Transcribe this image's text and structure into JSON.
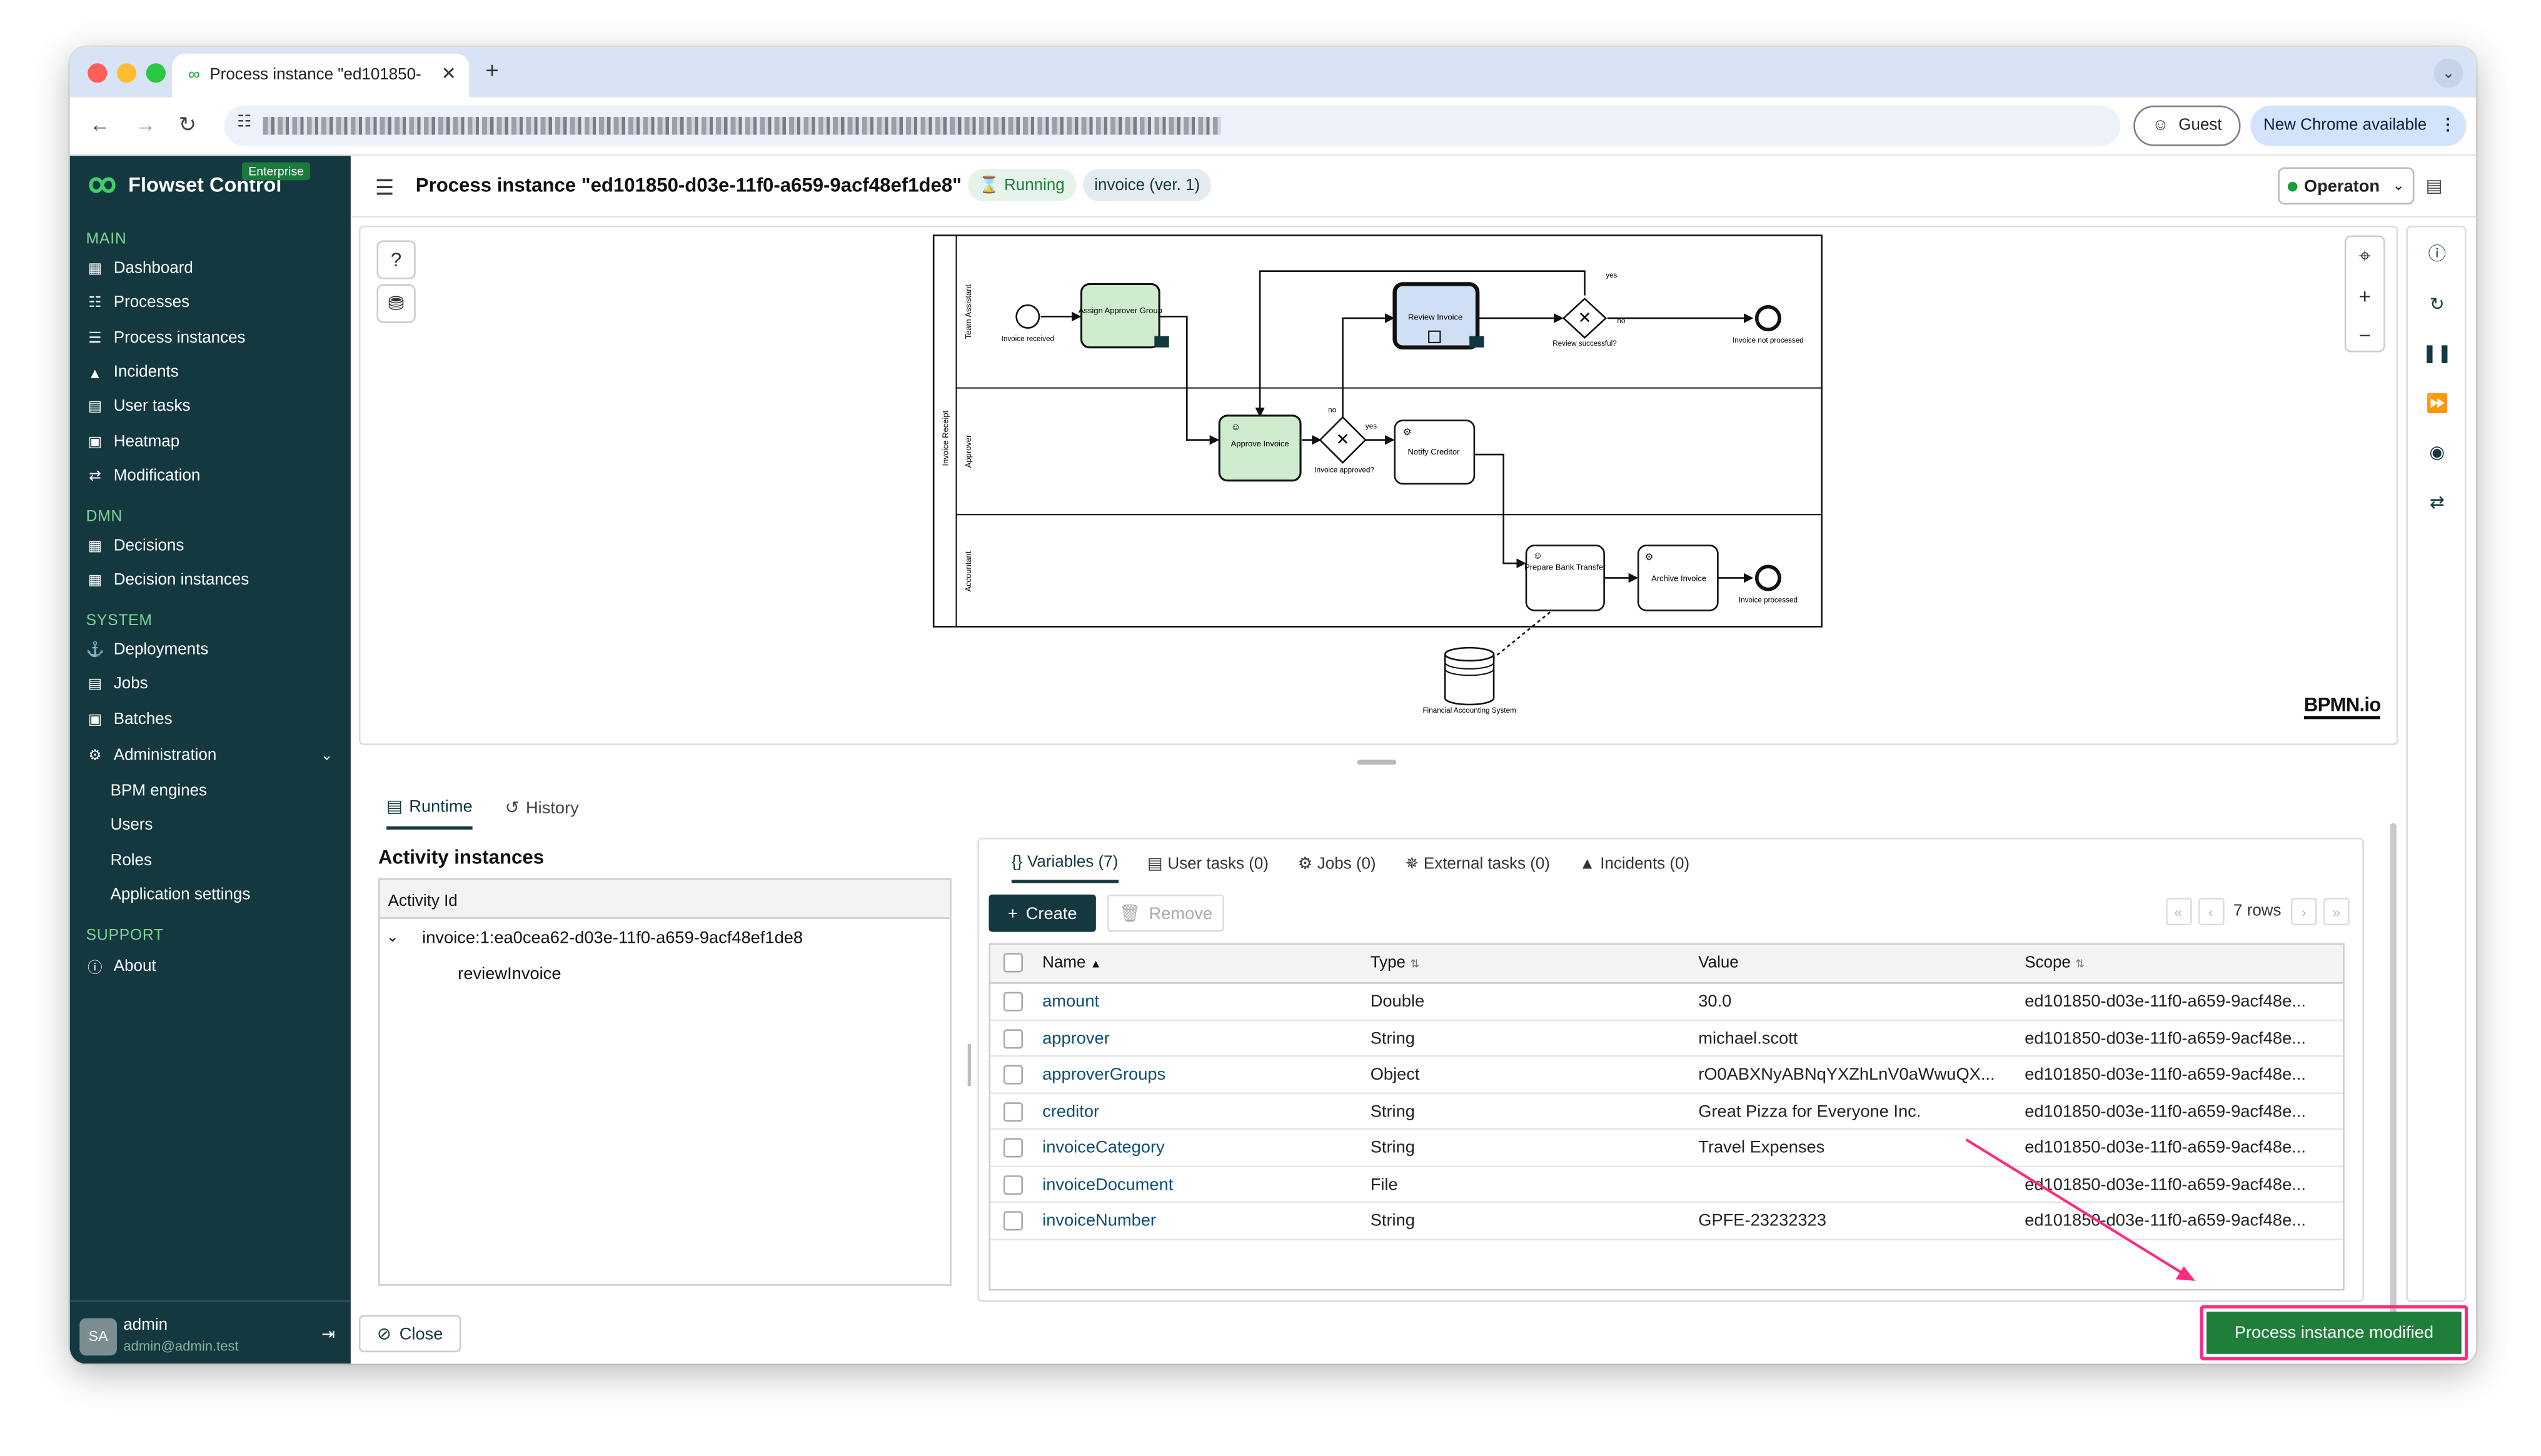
{
  "browser": {
    "tab_title": "Process instance \"ed101850-",
    "guest_label": "Guest",
    "chrome_available_label": "New Chrome available"
  },
  "colors": {
    "sidebar_bg": "#13383f",
    "section_label": "#7fd394",
    "accent": "#13383f",
    "success": "#1e7e3a",
    "highlight": "#ff2a80"
  },
  "sidebar": {
    "brand": "Flowset Control",
    "edition": "Enterprise",
    "sections": {
      "main": "MAIN",
      "dmn": "DMN",
      "system": "SYSTEM",
      "support": "SUPPORT"
    },
    "items": {
      "dashboard": "Dashboard",
      "processes": "Processes",
      "process_instances": "Process instances",
      "incidents": "Incidents",
      "user_tasks": "User tasks",
      "heatmap": "Heatmap",
      "modification": "Modification",
      "decisions": "Decisions",
      "decision_instances": "Decision instances",
      "deployments": "Deployments",
      "jobs": "Jobs",
      "batches": "Batches",
      "administration": "Administration",
      "bpm_engines": "BPM engines",
      "users": "Users",
      "roles": "Roles",
      "application_settings": "Application settings",
      "about": "About"
    },
    "user": {
      "initials": "SA",
      "name": "admin",
      "email": "admin@admin.test"
    }
  },
  "header": {
    "title": "Process instance \"ed101850-d03e-11f0-a659-9acf48ef1de8\"",
    "status": "Running",
    "definition": "invoice (ver. 1)",
    "engine": "Operaton"
  },
  "diagram": {
    "pools": [
      "Invoice Receipt"
    ],
    "lanes": [
      "Team Assistant",
      "Approver",
      "Accountant"
    ],
    "elements": {
      "invoice_received": "Invoice received",
      "assign_approver_group": "Assign Approver Group",
      "review_invoice": "Review Invoice",
      "review_successful": "Review successful?",
      "invoice_not_processed": "Invoice not processed",
      "approve_invoice": "Approve Invoice",
      "invoice_approved": "Invoice approved?",
      "notify_creditor": "Notify Creditor",
      "prepare_bank_transfer": "Prepare Bank Transfer",
      "archive_invoice": "Archive Invoice",
      "invoice_processed": "Invoice processed",
      "financial_accounting_system": "Financial Accounting System"
    },
    "flow_labels": {
      "yes_top": "yes",
      "no_top": "no",
      "yes_mid": "yes",
      "no_mid": "no"
    },
    "watermark": "BPMN.io"
  },
  "bottom_tabs": {
    "runtime": "Runtime",
    "history": "History"
  },
  "activity_instances": {
    "title": "Activity instances",
    "column": "Activity Id",
    "root": "invoice:1:ea0cea62-d03e-11f0-a659-9acf48ef1de8",
    "child": "reviewInvoice"
  },
  "variables_tabs": {
    "variables": "Variables (7)",
    "user_tasks": "User tasks (0)",
    "jobs": "Jobs (0)",
    "external_tasks": "External tasks (0)",
    "incidents": "Incidents (0)"
  },
  "variables": {
    "create_label": "Create",
    "remove_label": "Remove",
    "rows_label": "7 rows",
    "columns": [
      "Name",
      "Type",
      "Value",
      "Scope"
    ],
    "rows": [
      {
        "name": "amount",
        "type": "Double",
        "value": "30.0",
        "scope": "ed101850-d03e-11f0-a659-9acf48e..."
      },
      {
        "name": "approver",
        "type": "String",
        "value": "michael.scott",
        "scope": "ed101850-d03e-11f0-a659-9acf48e..."
      },
      {
        "name": "approverGroups",
        "type": "Object",
        "value": "rO0ABXNyABNqYXZhLnV0aWwuQX...",
        "scope": "ed101850-d03e-11f0-a659-9acf48e..."
      },
      {
        "name": "creditor",
        "type": "String",
        "value": "Great Pizza for Everyone Inc.",
        "scope": "ed101850-d03e-11f0-a659-9acf48e..."
      },
      {
        "name": "invoiceCategory",
        "type": "String",
        "value": "Travel Expenses",
        "scope": "ed101850-d03e-11f0-a659-9acf48e..."
      },
      {
        "name": "invoiceDocument",
        "type": "File",
        "value": "",
        "scope": "ed101850-d03e-11f0-a659-9acf48e..."
      },
      {
        "name": "invoiceNumber",
        "type": "String",
        "value": "GPFE-23232323",
        "scope": "ed101850-d03e-11f0-a659-9acf48e..."
      }
    ]
  },
  "footer": {
    "close_label": "Close",
    "toast": "Process instance modified"
  }
}
